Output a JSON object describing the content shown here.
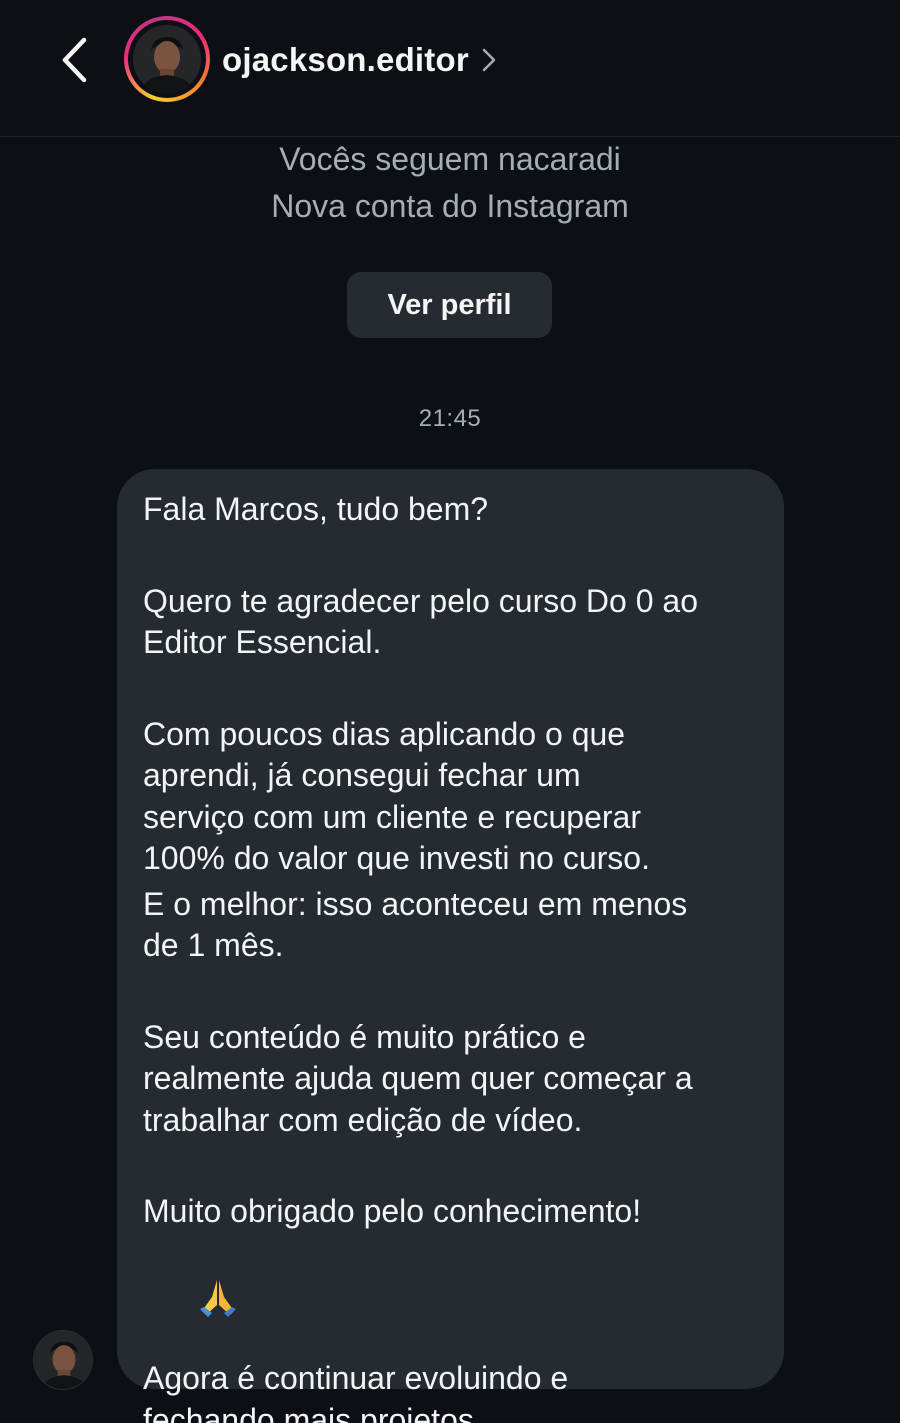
{
  "header": {
    "back_icon": "chevron-left-icon",
    "username": "ojackson.editor",
    "chevron_icon": "chevron-right-icon",
    "story_ring_colors": [
      "#f9ce34",
      "#ee2a7b",
      "#c13584",
      "#f58529"
    ]
  },
  "profile_info": {
    "follow_text": "Vocês seguem nacaradi",
    "account_text": "Nova conta do Instagram",
    "view_profile_label": "Ver perfil"
  },
  "thread": {
    "timestamp": "21:45",
    "message": {
      "greeting": "Fala Marcos, tudo bem?",
      "thanks": "Quero te agradecer pelo curso Do 0 ao\nEditor Essencial.",
      "result": "Com poucos dias aplicando o que\naprendi, já consegui fechar um\nserviço com um cliente e recuperar\n100% do valor que investi no curso.",
      "best": "E o melhor: isso aconteceu em menos\nde 1 mês.",
      "content": "Seu conteúdo é muito prático e\nrealmente ajuda quem quer começar a\ntrabalhar com edição de vídeo.",
      "closing": "Muito obrigado pelo conhecimento!",
      "emoji": "🙏",
      "final": "Agora é continuar evoluindo e\nfechando mais projetos."
    }
  },
  "colors": {
    "background": "#0c1015",
    "bubble": "#262a31",
    "secondary_text": "#a8acb3",
    "primary_text": "#f3f4f6"
  }
}
